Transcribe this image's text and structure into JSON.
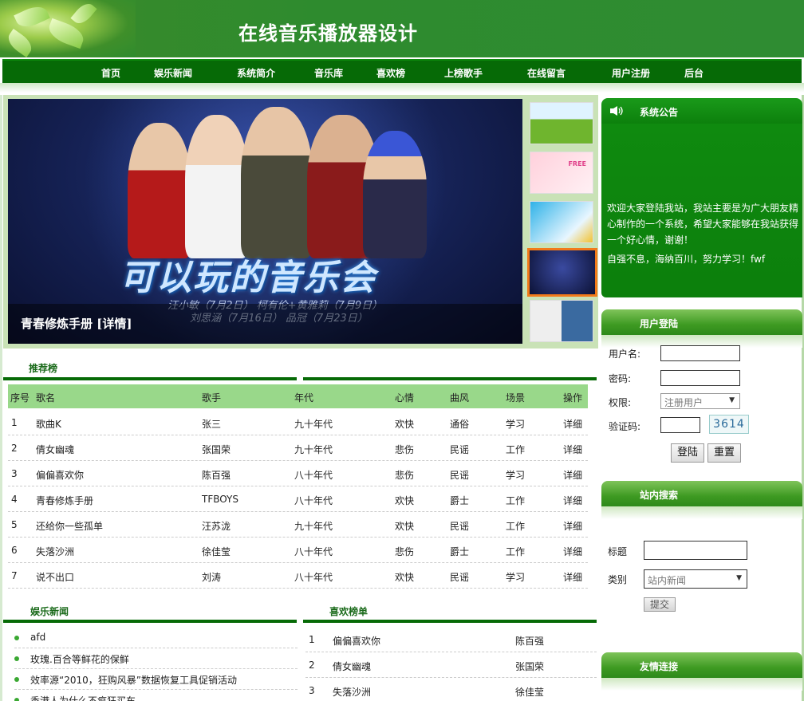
{
  "header": {
    "title": "在线音乐播放器设计"
  },
  "nav": [
    "首页",
    "娱乐新闻",
    "系统简介",
    "音乐库",
    "喜欢榜",
    "上榜歌手",
    "在线留言",
    "用户注册",
    "后台"
  ],
  "slider": {
    "caption": "青春修炼手册 [详情]",
    "banner_title": "可以玩的音乐会",
    "banner_dates": [
      "汪小敏（7月2日） 柯有伦+黄雅莉（7月9日）",
      "刘思涵（7月16日） 品冠（7月23日）"
    ],
    "thumb_text": "FREE"
  },
  "recommend": {
    "title": "推荐榜",
    "columns": [
      "序号",
      "歌名",
      "歌手",
      "年代",
      "心情",
      "曲风",
      "场景",
      "操作"
    ],
    "rows": [
      [
        "1",
        "歌曲K",
        "张三",
        "九十年代",
        "欢快",
        "通俗",
        "学习",
        "详细"
      ],
      [
        "2",
        "倩女幽魂",
        "张国荣",
        "九十年代",
        "悲伤",
        "民谣",
        "工作",
        "详细"
      ],
      [
        "3",
        "偏偏喜欢你",
        "陈百强",
        "八十年代",
        "悲伤",
        "民谣",
        "学习",
        "详细"
      ],
      [
        "4",
        "青春修炼手册",
        "TFBOYS",
        "八十年代",
        "欢快",
        "爵士",
        "工作",
        "详细"
      ],
      [
        "5",
        "还给你一些孤单",
        "汪苏泷",
        "九十年代",
        "欢快",
        "民谣",
        "工作",
        "详细"
      ],
      [
        "6",
        "失落沙洲",
        "徐佳莹",
        "八十年代",
        "悲伤",
        "爵士",
        "工作",
        "详细"
      ],
      [
        "7",
        "说不出口",
        "刘涛",
        "八十年代",
        "欢快",
        "民谣",
        "学习",
        "详细"
      ]
    ]
  },
  "news": {
    "title": "娱乐新闻",
    "items": [
      "afd",
      "玫瑰.百合等鲜花的保鲜",
      "效率源“2010，狂购风暴”数据恢复工具促销活动",
      "香港人为什么不疯狂买车"
    ]
  },
  "favorites": {
    "title": "喜欢榜单",
    "rows": [
      [
        "1",
        "偏偏喜欢你",
        "陈百强"
      ],
      [
        "2",
        "倩女幽魂",
        "张国荣"
      ],
      [
        "3",
        "失落沙洲",
        "徐佳莹"
      ]
    ]
  },
  "notice": {
    "title": "系统公告",
    "text1": "欢迎大家登陆我站，我站主要是为广大朋友精心制作的一个系统，希望大家能够在我站获得一个好心情，谢谢！",
    "text2": "自强不息，海纳百川，努力学习！fwf"
  },
  "login": {
    "title": "用户登陆",
    "username_label": "用户名:",
    "password_label": "密码:",
    "role_label": "权限:",
    "role_value": "注册用户",
    "captcha_label": "验证码:",
    "captcha_value": "3614",
    "login_button": "登陆",
    "reset_button": "重置"
  },
  "search": {
    "title": "站内搜索",
    "title_label": "标题",
    "category_label": "类别",
    "category_value": "站内新闻",
    "submit_button": "提交"
  },
  "links": {
    "title": "友情连接"
  }
}
